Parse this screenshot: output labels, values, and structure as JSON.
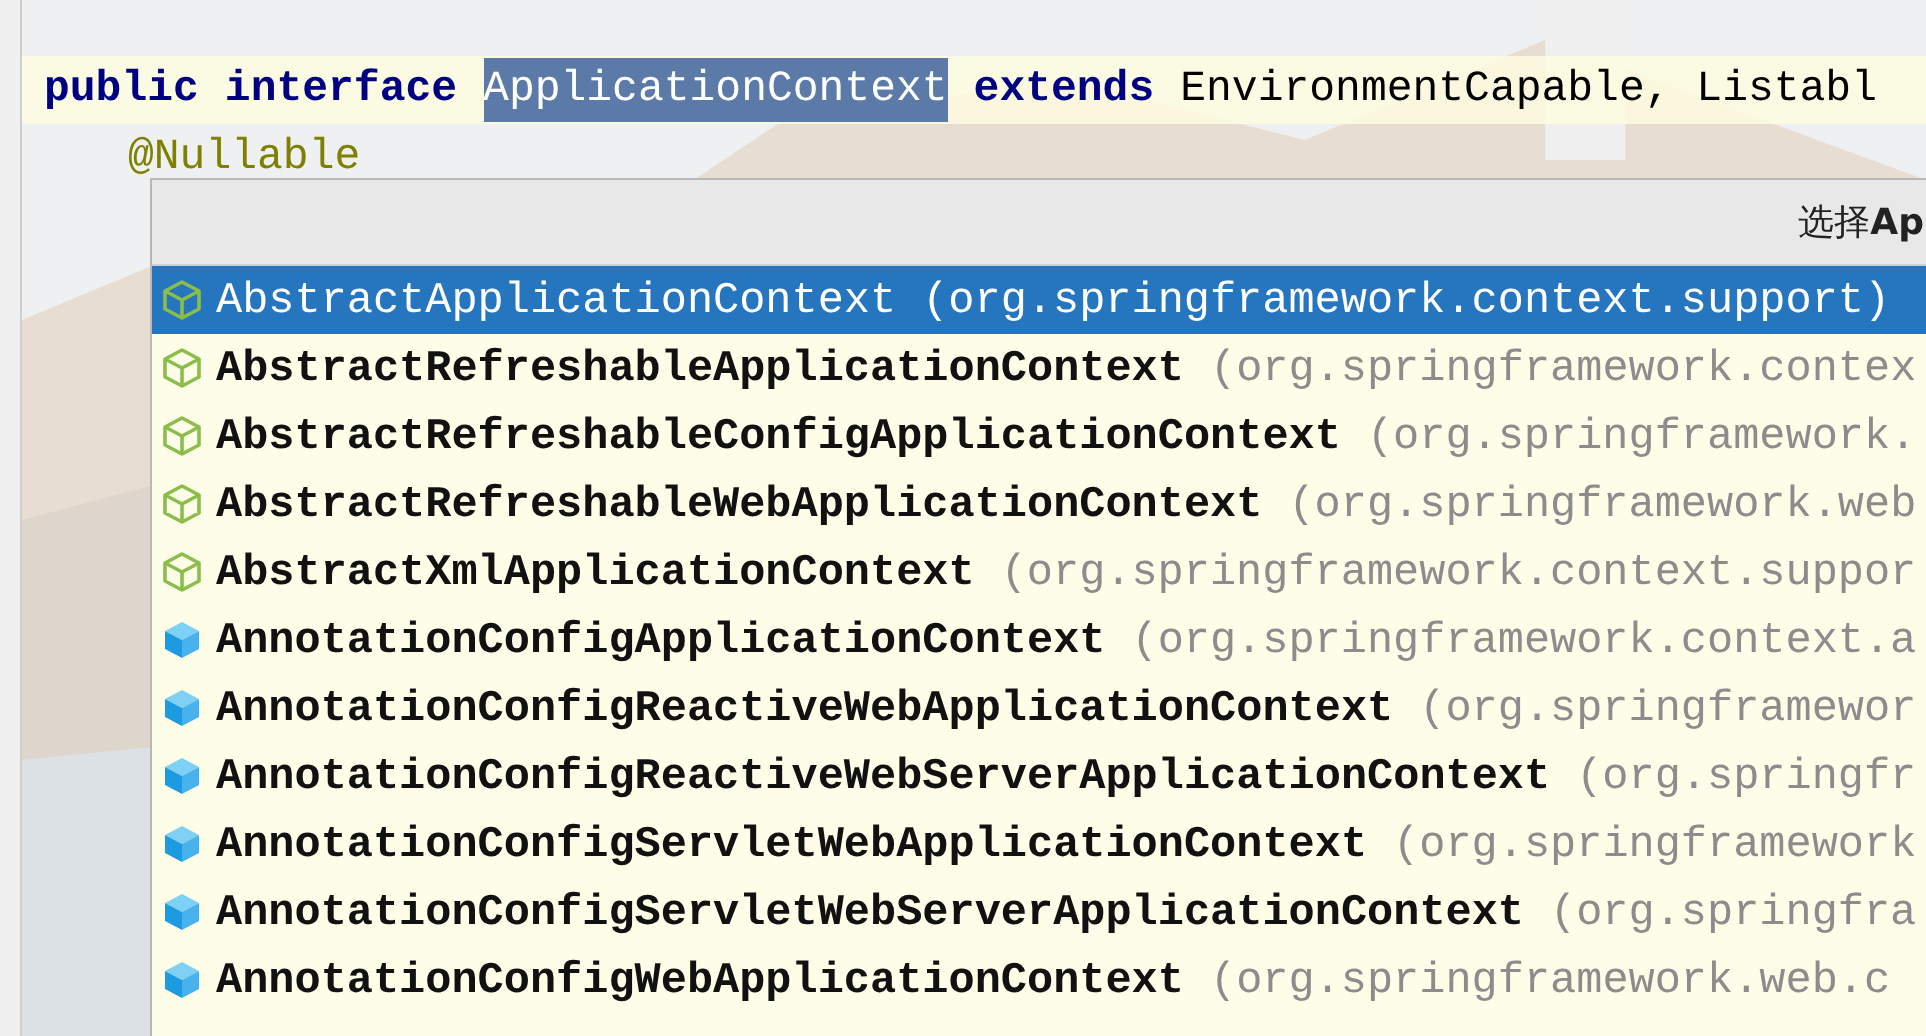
{
  "code_lines": [
    {
      "tokens": [
        {
          "text": "public",
          "kind": "keyword"
        },
        {
          "text": "interface",
          "kind": "keyword"
        },
        {
          "text": "ApplicationContext",
          "kind": "selected"
        },
        {
          "text": "extends",
          "kind": "keyword"
        },
        {
          "text": "EnvironmentCapable, Listabl",
          "kind": "plain"
        }
      ],
      "current": true
    },
    {
      "tokens": [
        {
          "text": "@Nullable",
          "kind": "annotation"
        }
      ],
      "current": false
    }
  ],
  "popup": {
    "title": "选择**Ap**",
    "items": [
      {
        "name": "AbstractApplicationContext",
        "package": "(org.springframework.context.support)",
        "kind": "abstract",
        "selected": true
      },
      {
        "name": "AbstractRefreshableApplicationContext",
        "package": "(org.springframework.contex",
        "kind": "abstract",
        "selected": false
      },
      {
        "name": "AbstractRefreshableConfigApplicationContext",
        "package": "(org.springframework.",
        "kind": "abstract",
        "selected": false
      },
      {
        "name": "AbstractRefreshableWebApplicationContext",
        "package": "(org.springframework.web",
        "kind": "abstract",
        "selected": false
      },
      {
        "name": "AbstractXmlApplicationContext",
        "package": "(org.springframework.context.suppor",
        "kind": "abstract",
        "selected": false
      },
      {
        "name": "AnnotationConfigApplicationContext",
        "package": "(org.springframework.context.a",
        "kind": "class",
        "selected": false
      },
      {
        "name": "AnnotationConfigReactiveWebApplicationContext",
        "package": "(org.springframewor",
        "kind": "class",
        "selected": false
      },
      {
        "name": "AnnotationConfigReactiveWebServerApplicationContext",
        "package": "(org.springfr",
        "kind": "class",
        "selected": false
      },
      {
        "name": "AnnotationConfigServletWebApplicationContext",
        "package": "(org.springframework",
        "kind": "class",
        "selected": false
      },
      {
        "name": "AnnotationConfigServletWebServerApplicationContext",
        "package": "(org.springfra",
        "kind": "class",
        "selected": false
      },
      {
        "name": "AnnotationConfigWebApplicationContext",
        "package": "(org.springframework.web.c",
        "kind": "class",
        "selected": false
      }
    ]
  }
}
